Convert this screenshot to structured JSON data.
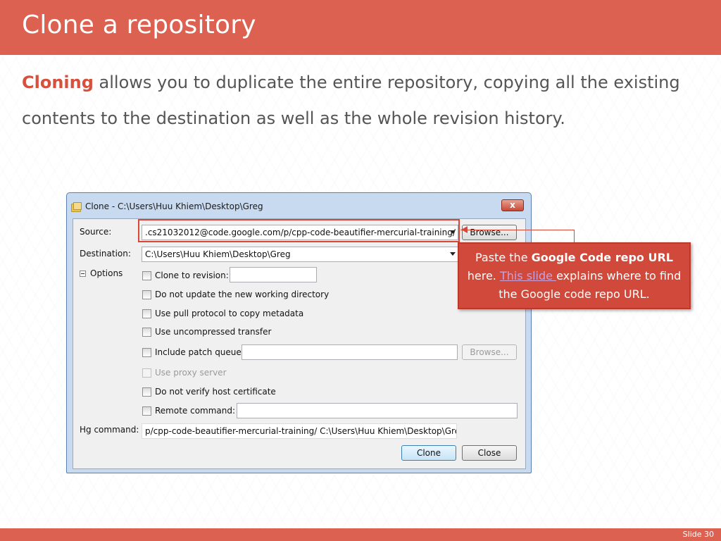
{
  "slide": {
    "title": "Clone a repository",
    "body_highlight": "Cloning",
    "body_rest": " allows you to duplicate the entire repository, copying all the existing contents to the destination as well as the whole revision history.",
    "slide_number": "Slide 30",
    "accent_color": "#dd6150"
  },
  "dialog": {
    "window_title": "Clone - C:\\Users\\Huu Khiem\\Desktop\\Greg",
    "close_label": "x",
    "source_label": "Source:",
    "source_value": ".cs21032012@code.google.com/p/cpp-code-beautifier-mercurial-training/",
    "source_browse": "Browse...",
    "destination_label": "Destination:",
    "destination_value": "C:\\Users\\Huu Khiem\\Desktop\\Greg",
    "options_label": "Options",
    "options": [
      {
        "label": "Clone to revision:",
        "enabled": true
      },
      {
        "label": "Do not update the new working directory",
        "enabled": true
      },
      {
        "label": "Use pull protocol to copy metadata",
        "enabled": true
      },
      {
        "label": "Use uncompressed transfer",
        "enabled": true
      },
      {
        "label": "Include patch queue",
        "enabled": true
      },
      {
        "label": "Use proxy server",
        "enabled": false
      },
      {
        "label": "Do not verify host certificate",
        "enabled": true
      },
      {
        "label": "Remote command:",
        "enabled": true
      }
    ],
    "patch_browse": "Browse...",
    "hg_command_label": "Hg command:",
    "hg_command_value": "p/cpp-code-beautifier-mercurial-training/ C:\\Users\\Huu Khiem\\Desktop\\Greg",
    "clone_button": "Clone",
    "close_button": "Close"
  },
  "callout": {
    "text_1": "Paste the ",
    "bold": "Google Code repo URL",
    "text_2": " here. ",
    "link": "This slide ",
    "text_3": "explains where to find the Google code repo URL."
  }
}
